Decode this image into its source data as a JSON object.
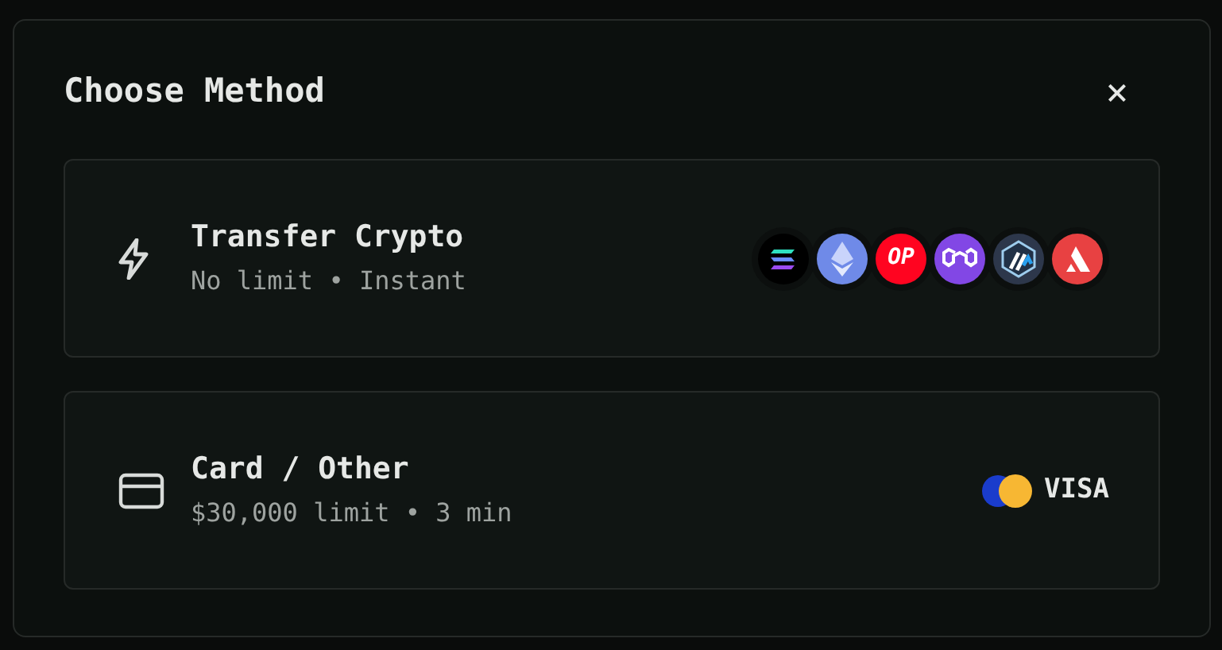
{
  "dialog": {
    "title": "Choose Method",
    "close": "×"
  },
  "methods": [
    {
      "kind": "crypto",
      "title": "Transfer Crypto",
      "subtitle": "No limit • Instant",
      "networks": [
        {
          "kind": "solana"
        },
        {
          "kind": "ethereum"
        },
        {
          "kind": "optimism",
          "label": "OP"
        },
        {
          "kind": "polygon"
        },
        {
          "kind": "arbitrum"
        },
        {
          "kind": "avalanche"
        }
      ]
    },
    {
      "kind": "card",
      "title": "Card / Other",
      "subtitle": "$30,000 limit • 3 min",
      "brand": "VISA"
    }
  ]
}
